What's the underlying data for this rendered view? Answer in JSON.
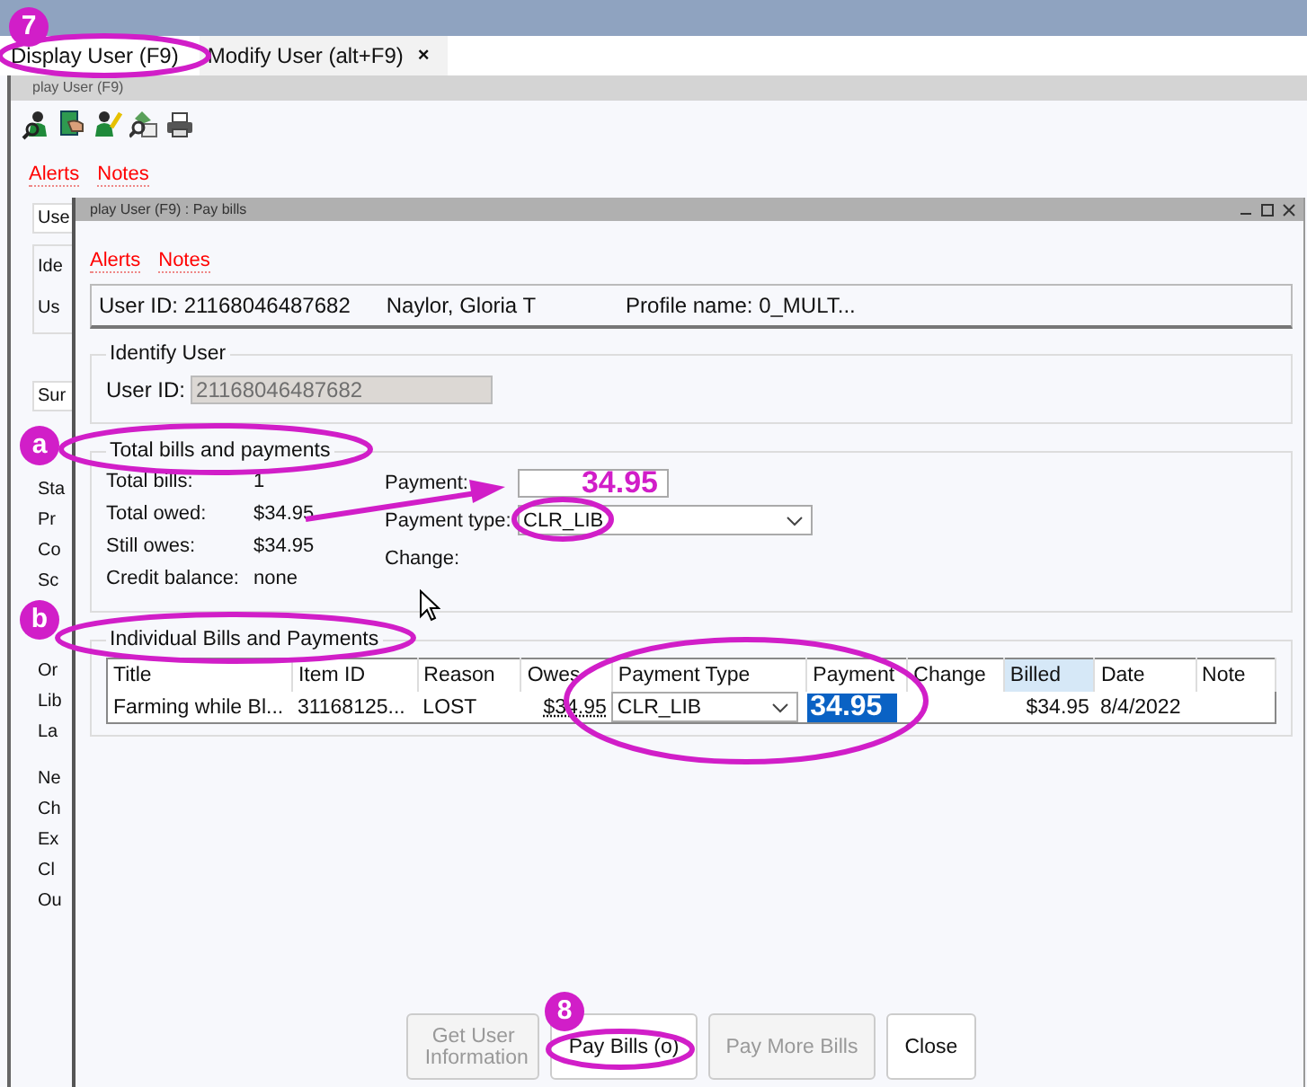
{
  "tabs": [
    {
      "label": "Display User (F9)",
      "selected": true
    },
    {
      "label": "Modify User (alt+F9)",
      "selected": false,
      "close": "×"
    }
  ],
  "back_window": {
    "title": "play User (F9)",
    "links": [
      "Alerts",
      "Notes"
    ],
    "tab_label": "Use",
    "group_labels": [
      "Ide",
      "Us"
    ],
    "side_tab": "Sur",
    "side_groups": [
      [
        "Sta",
        "Pr",
        "Co",
        "Sc"
      ],
      [
        "Or",
        "Lib",
        "La"
      ],
      [
        "Ne",
        "Ch",
        "Ex",
        "Cl",
        "Ou"
      ]
    ]
  },
  "dialog": {
    "title": "play User (F9) : Pay bills",
    "links": [
      "Alerts",
      "Notes"
    ],
    "user_id": "User ID: 21168046487682",
    "user_name": "Naylor, Gloria T",
    "profile": "Profile name: 0_MULT...",
    "identify": {
      "legend": "Identify User",
      "label": "User ID:",
      "value": "21168046487682",
      "disabled": true
    },
    "totals": {
      "legend": "Total bills and payments",
      "rows": [
        {
          "label": "Total bills:",
          "value": "1"
        },
        {
          "label": "Total owed:",
          "value": "$34.95"
        },
        {
          "label": "Still owes:",
          "value": "$34.95"
        },
        {
          "label": "Credit balance:",
          "value": "none"
        }
      ],
      "payment_label": "Payment:",
      "payment_value": "34.95",
      "type_label": "Payment type:",
      "type_value": "CLR_LIB",
      "change_label": "Change:"
    },
    "bills": {
      "legend": "Individual Bills and Payments",
      "columns": [
        {
          "label": "Title",
          "highlighted": false
        },
        {
          "label": "Item ID",
          "highlighted": false
        },
        {
          "label": "Reason",
          "highlighted": false
        },
        {
          "label": "Owes",
          "highlighted": false
        },
        {
          "label": "Payment Type",
          "highlighted": false
        },
        {
          "label": "Payment",
          "highlighted": false
        },
        {
          "label": "Change",
          "highlighted": false
        },
        {
          "label": "Billed",
          "highlighted": true
        },
        {
          "label": "Date",
          "highlighted": false
        },
        {
          "label": "Note",
          "highlighted": false
        }
      ],
      "rows": [
        {
          "title": "Farming while Bl...",
          "item_id": "31168125...",
          "reason": "LOST",
          "owes": "$34.95",
          "payment_type": "CLR_LIB",
          "payment": "34.95",
          "billed": "$34.95",
          "date": "8/4/2022"
        }
      ]
    },
    "buttons": [
      {
        "label": "Get User Information",
        "disabled": true
      },
      {
        "label": "Pay Bills (o)",
        "disabled": false
      },
      {
        "label": "Pay More Bills",
        "disabled": true
      },
      {
        "label": "Close",
        "disabled": false
      }
    ]
  },
  "annotations": [
    {
      "label": "7"
    },
    {
      "label": "a"
    },
    {
      "label": "b"
    },
    {
      "label": "8"
    }
  ]
}
